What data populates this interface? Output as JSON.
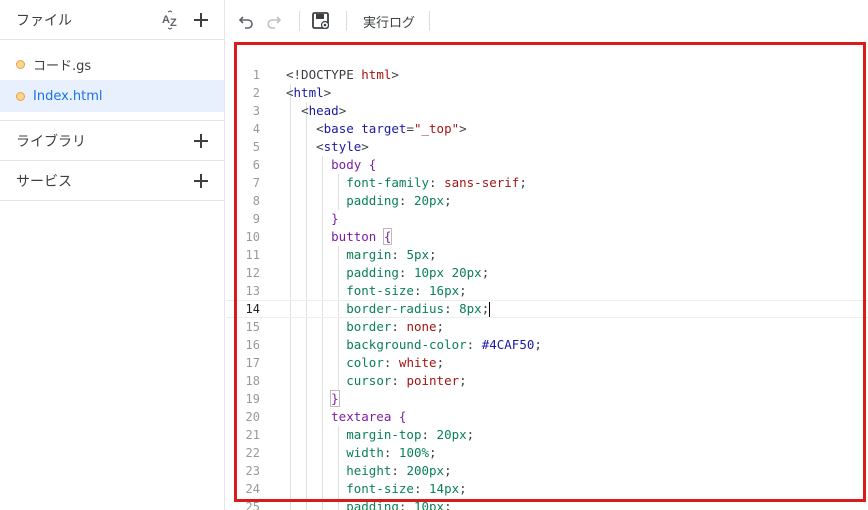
{
  "sidebar": {
    "files_title": "ファイル",
    "files": [
      {
        "name": "コード.gs",
        "active": false
      },
      {
        "name": "Index.html",
        "active": true
      }
    ],
    "libraries_title": "ライブラリ",
    "services_title": "サービス"
  },
  "toolbar": {
    "exec_log_label": "実行ログ"
  },
  "editor": {
    "current_line": 14,
    "lines": [
      "1",
      "2",
      "3",
      "4",
      "5",
      "6",
      "7",
      "8",
      "9",
      "10",
      "11",
      "12",
      "13",
      "14",
      "15",
      "16",
      "17",
      "18",
      "19",
      "20",
      "21",
      "22",
      "23",
      "24",
      "25"
    ]
  },
  "colors": {
    "accent": "#1a73e8",
    "highlight_border": "#d81b1b",
    "file_dot": "#fbd597"
  }
}
